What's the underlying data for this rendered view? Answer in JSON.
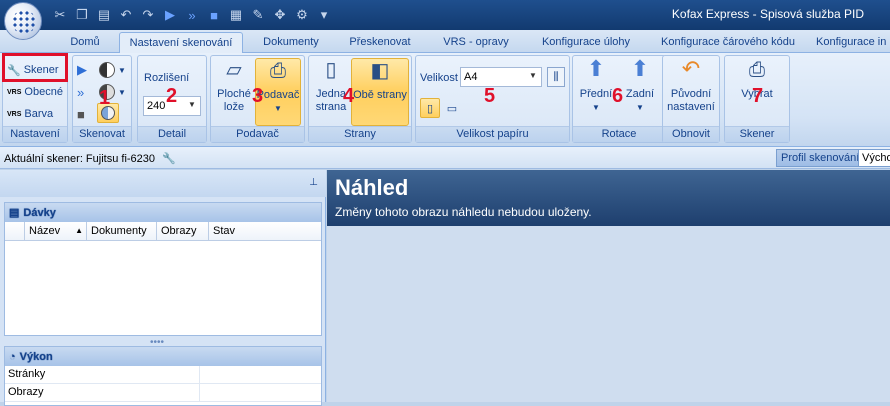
{
  "window": {
    "title": "Kofax Express - Spisová služba PID"
  },
  "tabs": [
    {
      "label": "Domů"
    },
    {
      "label": "Nastavení skenování",
      "active": true
    },
    {
      "label": "Dokumenty"
    },
    {
      "label": "Přeskenovat"
    },
    {
      "label": "VRS - opravy"
    },
    {
      "label": "Konfigurace úlohy"
    },
    {
      "label": "Konfigurace čárového kódu"
    },
    {
      "label": "Konfigurace in"
    }
  ],
  "ribbon": {
    "nastaveni": {
      "label": "Nastavení",
      "skener": "Skener",
      "obecne": "Obecné",
      "barva": "Barva",
      "vrs1": "VRS",
      "vrs2": "VRS"
    },
    "skenovat": {
      "label": "Skenovat"
    },
    "detail": {
      "label": "Detail",
      "rozliseni": "Rozlišení",
      "resolution_value": "240"
    },
    "podavac": {
      "label": "Podavač",
      "flatbed_line1": "Ploché",
      "flatbed_line2": "lože",
      "feeder": "Podavač"
    },
    "strany": {
      "label": "Strany",
      "single_line1": "Jedna",
      "single_line2": "strana",
      "both": "Obě strany"
    },
    "paper": {
      "label": "Velikost papíru",
      "velikost": "Velikost",
      "size_value": "A4"
    },
    "rotace": {
      "label": "Rotace",
      "front": "Přední",
      "back": "Zadní"
    },
    "obnovit": {
      "label": "Obnovit",
      "line1": "Původní",
      "line2": "nastavení"
    },
    "skener": {
      "label": "Skener",
      "select": "Vybrat"
    }
  },
  "annotations": [
    "1",
    "2",
    "3",
    "4",
    "5",
    "6",
    "7"
  ],
  "infobar": {
    "current_scanner": "Aktuální skener: Fujitsu fi-6230",
    "profile_label": "Profil skenování",
    "profile_value": "Výchozí"
  },
  "left_panel": {
    "batches": {
      "title": "Dávky",
      "columns": [
        "Název",
        "Dokumenty",
        "Obrazy",
        "Stav"
      ]
    },
    "performance": {
      "title": "Výkon",
      "rows": [
        "Stránky",
        "Obrazy"
      ]
    }
  },
  "preview": {
    "title": "Náhled",
    "subtitle": "Změny tohoto obrazu náhledu nebudou uloženy."
  },
  "colors": {
    "accent": "#15428b",
    "highlight": "#e0102a",
    "selected": "#ffcf5e"
  }
}
